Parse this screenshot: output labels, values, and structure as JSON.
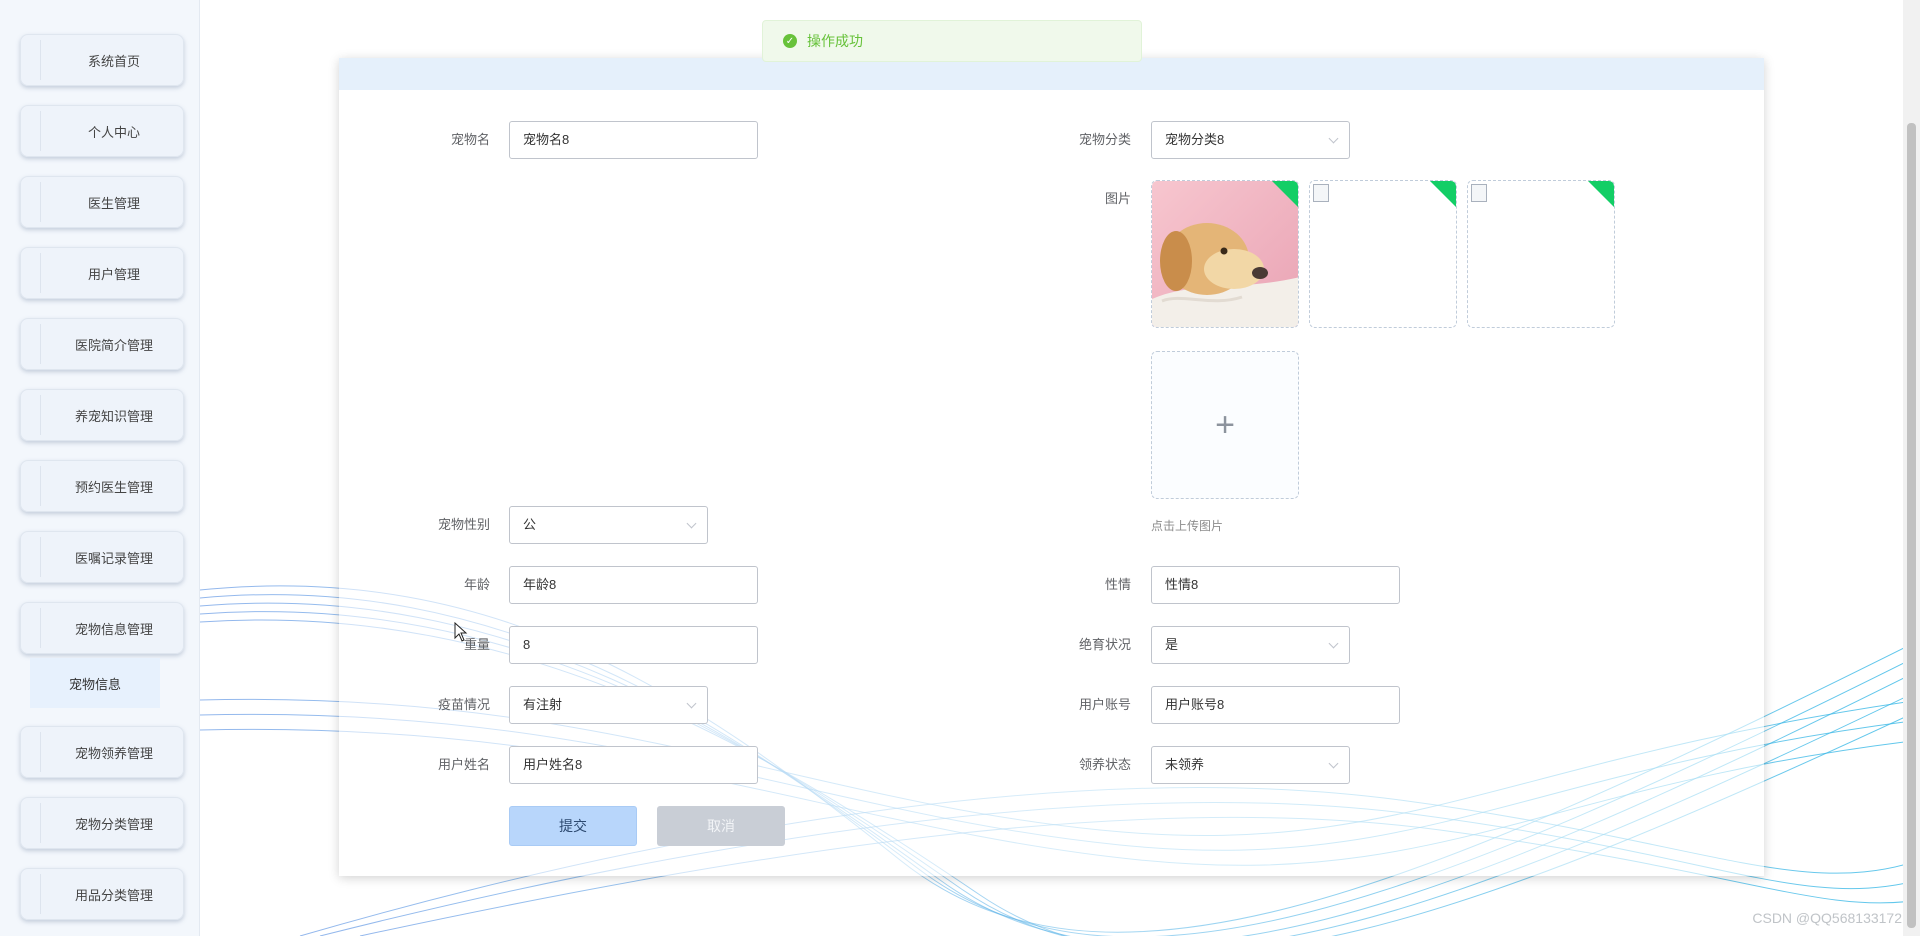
{
  "sidebar": {
    "items": [
      {
        "label": "系统首页"
      },
      {
        "label": "个人中心"
      },
      {
        "label": "医生管理"
      },
      {
        "label": "用户管理"
      },
      {
        "label": "医院简介管理"
      },
      {
        "label": "养宠知识管理"
      },
      {
        "label": "预约医生管理"
      },
      {
        "label": "医嘱记录管理"
      },
      {
        "label": "宠物信息管理"
      },
      {
        "label": "宠物领养管理"
      },
      {
        "label": "宠物分类管理"
      },
      {
        "label": "用品分类管理"
      }
    ],
    "submenu": {
      "label": "宠物信息"
    }
  },
  "toast": {
    "message": "操作成功",
    "icon": "check-circle-icon",
    "color": "#67c23a"
  },
  "form": {
    "pet_name": {
      "label": "宠物名",
      "value": "宠物名8"
    },
    "pet_category": {
      "label": "宠物分类",
      "value": "宠物分类8"
    },
    "images": {
      "label": "图片",
      "upload_hint": "点击上传图片"
    },
    "pet_gender": {
      "label": "宠物性别",
      "value": "公"
    },
    "age": {
      "label": "年龄",
      "value": "年龄8"
    },
    "temperament": {
      "label": "性情",
      "value": "性情8"
    },
    "weight": {
      "label": "重量",
      "value": "8"
    },
    "sterilized": {
      "label": "绝育状况",
      "value": "是"
    },
    "vaccine": {
      "label": "疫苗情况",
      "value": "有注射"
    },
    "user_account": {
      "label": "用户账号",
      "value": "用户账号8"
    },
    "user_name": {
      "label": "用户姓名",
      "value": "用户姓名8"
    },
    "adopt_status": {
      "label": "领养状态",
      "value": "未领养"
    }
  },
  "buttons": {
    "submit": "提交",
    "cancel": "取消"
  },
  "watermark": "CSDN @QQ568133172",
  "colors": {
    "accent_green": "#13ce66",
    "primary_light": "#b8d6fb",
    "header_band": "#e5f0fb"
  }
}
